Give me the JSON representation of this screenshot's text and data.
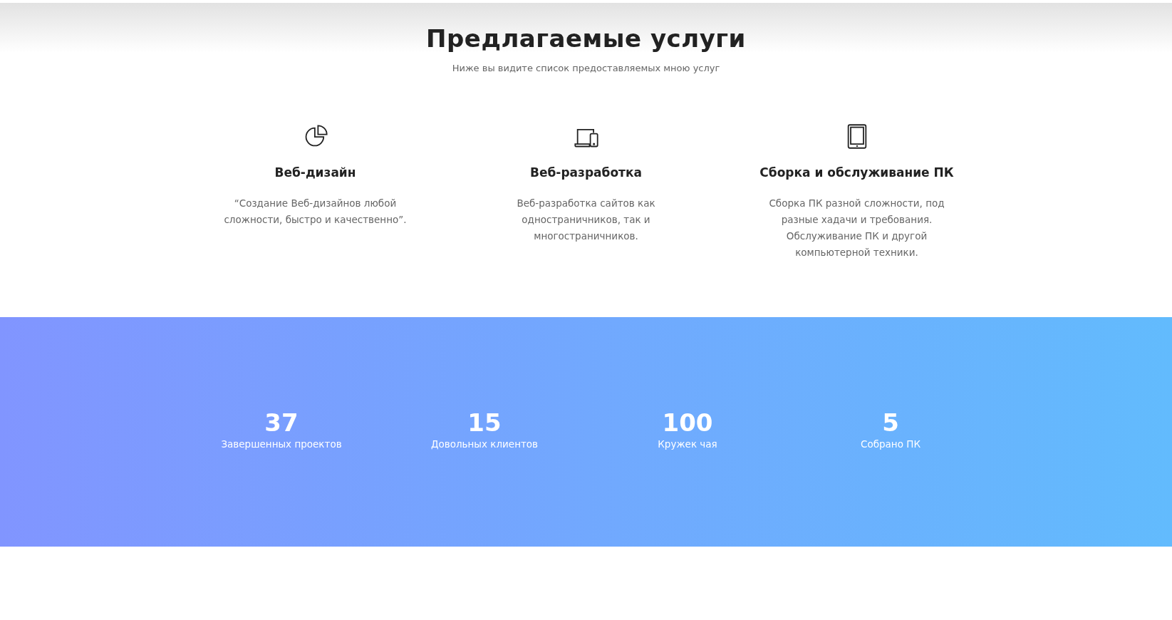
{
  "header": {
    "title": "Предлагаемые услуги",
    "subtitle": "Ниже вы видите список предоставляемых мною услуг"
  },
  "services": [
    {
      "kind": "pie",
      "title": "Веб-дизайн",
      "description": "“Создание Веб-дизайнов любой сложности, быстро и качественно”."
    },
    {
      "kind": "devices",
      "title": "Веб-разработка",
      "description": "Веб-разработка сайтов как одностраничников, так и многостраничников."
    },
    {
      "kind": "tablet",
      "title": "Сборка и обслуживание ПК",
      "description": "Сборка ПК разной сложности, под разные хадачи и требования. Обслуживание ПК и другой компьютерной техники."
    }
  ],
  "stats": [
    {
      "value": "37",
      "label": "Завершенных проектов"
    },
    {
      "value": "15",
      "label": "Довольных клиентов"
    },
    {
      "value": "100",
      "label": "Кружек чая"
    },
    {
      "value": "5",
      "label": "Собрано ПК"
    }
  ]
}
